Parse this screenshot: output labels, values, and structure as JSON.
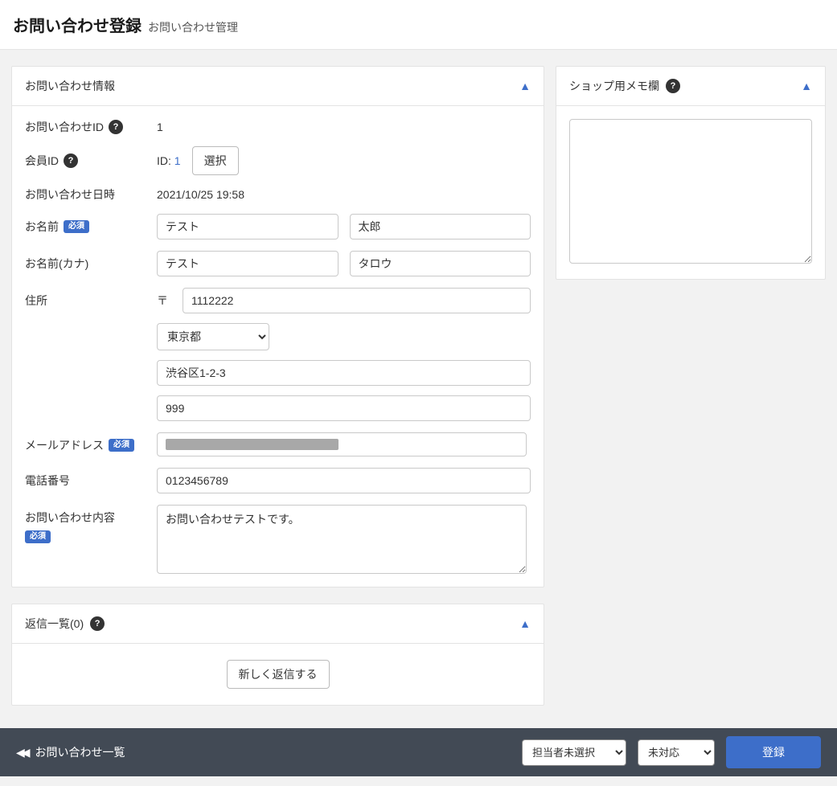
{
  "header": {
    "title": "お問い合わせ登録",
    "subtitle": "お問い合わせ管理"
  },
  "inquiry_panel": {
    "title": "お問い合わせ情報",
    "labels": {
      "id": "お問い合わせID",
      "customer_id": "会員ID",
      "datetime": "お問い合わせ日時",
      "name": "お名前",
      "kana": "お名前(カナ)",
      "address": "住所",
      "email": "メールアドレス",
      "phone": "電話番号",
      "content": "お問い合わせ内容"
    },
    "required": "必須",
    "id_prefix": "ID:",
    "zip_prefix": "〒",
    "select_button": "選択",
    "values": {
      "inquiry_id": "1",
      "customer_id": "1",
      "datetime": "2021/10/25 19:58",
      "last_name": "テスト",
      "first_name": "太郎",
      "last_kana": "テスト",
      "first_kana": "タロウ",
      "zip": "1112222",
      "pref": "東京都",
      "addr1": "渋谷区1-2-3",
      "addr2": "999",
      "email": "",
      "phone": "0123456789",
      "content": "お問い合わせテストです。"
    }
  },
  "reply_panel": {
    "title": "返信一覧(0)",
    "new_reply_button": "新しく返信する"
  },
  "memo_panel": {
    "title": "ショップ用メモ欄",
    "value": ""
  },
  "footer": {
    "back_label": "お問い合わせ一覧",
    "assignee_select": "担当者未選択",
    "status_select": "未対応",
    "submit": "登録"
  }
}
